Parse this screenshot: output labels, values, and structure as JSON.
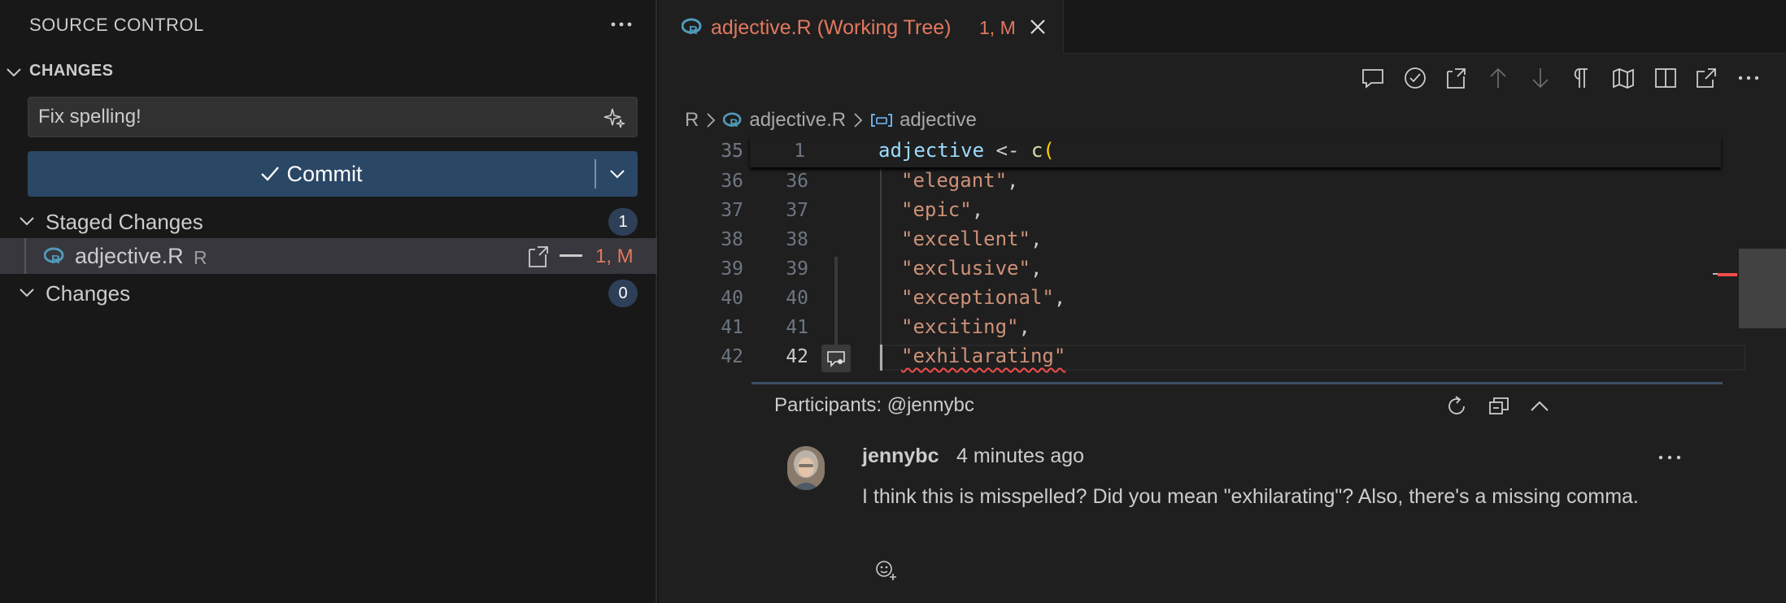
{
  "sidebar": {
    "title": "SOURCE CONTROL",
    "section_title": "CHANGES",
    "commit_message": "Fix spelling!",
    "commit_label": "Commit",
    "staged": {
      "label": "Staged Changes",
      "count": "1"
    },
    "file": {
      "name": "adjective.R",
      "dir": "R",
      "status": "1, M"
    },
    "changes": {
      "label": "Changes",
      "count": "0"
    }
  },
  "editor": {
    "tab": {
      "title": "adjective.R (Working Tree)",
      "status": "1, M"
    },
    "breadcrumb": {
      "folder": "R",
      "file": "adjective.R",
      "symbol": "adjective"
    },
    "lines": [
      {
        "old": "35",
        "new": "1"
      },
      {
        "old": "36",
        "new": "36",
        "text": "\"elegant\"",
        "trail": ","
      },
      {
        "old": "37",
        "new": "37",
        "text": "\"epic\"",
        "trail": ","
      },
      {
        "old": "38",
        "new": "38",
        "text": "\"excellent\"",
        "trail": ","
      },
      {
        "old": "39",
        "new": "39",
        "text": "\"exclusive\"",
        "trail": ","
      },
      {
        "old": "40",
        "new": "40",
        "text": "\"exceptional\"",
        "trail": ","
      },
      {
        "old": "41",
        "new": "41",
        "text": "\"exciting\"",
        "trail": ","
      },
      {
        "old": "42",
        "new": "42",
        "text": "\"exhilarating\"",
        "trail": ""
      }
    ],
    "sticky": {
      "var": "adjective",
      "op": " <- ",
      "fn": "c",
      "brace": "("
    }
  },
  "comment": {
    "participants": "Participants: @jennybc",
    "author": "jennybc",
    "time": "4 minutes ago",
    "body": "I think this is misspelled? Did you mean \"exhilarating\"? Also, there's a missing comma."
  },
  "colors": {
    "accent_modified": "#e2785f",
    "commit_button": "#2b4766",
    "badge": "#2e4057",
    "string": "#ce9178",
    "variable": "#9cdcfe",
    "function": "#dcdcaa",
    "error": "#f14c4c"
  },
  "icons": [
    "ellipsis-icon",
    "chevron-down-icon",
    "sparkle-icon",
    "check-icon",
    "r-file-icon",
    "open-file-icon",
    "minus-icon",
    "close-icon",
    "comment-icon",
    "check-circle-icon",
    "file-go-icon",
    "arrow-up-icon",
    "arrow-down-icon",
    "pilcrow-icon",
    "map-icon",
    "split-icon",
    "open-external-icon",
    "symbol-variable-icon",
    "refresh-icon",
    "collapse-all-icon",
    "chevron-up-icon",
    "reaction-icon"
  ]
}
